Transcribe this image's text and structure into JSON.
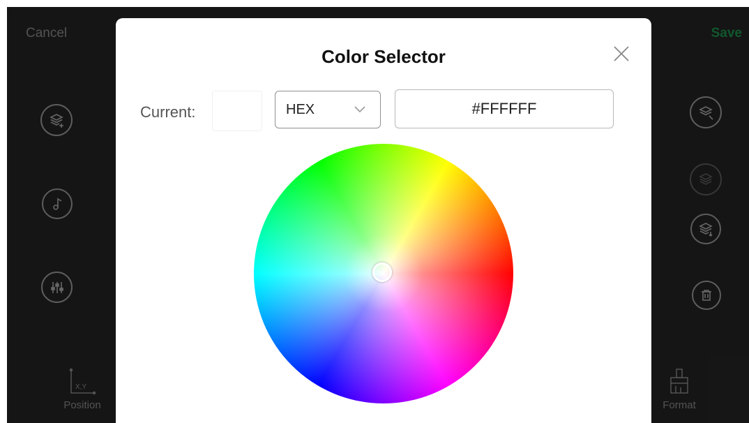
{
  "header": {
    "cancel_label": "Cancel",
    "save_label": "Save"
  },
  "toolbar_left": [
    {
      "icon": "add-layer-icon"
    },
    {
      "icon": "music-note-icon"
    },
    {
      "icon": "equalizer-icon"
    }
  ],
  "toolbar_right": [
    {
      "icon": "select-layer-icon"
    },
    {
      "icon": "layer-up-icon",
      "disabled": true
    },
    {
      "icon": "layer-down-icon"
    },
    {
      "icon": "trash-icon"
    }
  ],
  "bottom_tools": {
    "position": {
      "label": "Position",
      "icon_text": "X,Y"
    },
    "format": {
      "label": "Format"
    }
  },
  "dialog": {
    "title": "Color Selector",
    "current_label": "Current:",
    "current_color": "#FFFFFF",
    "format_value": "HEX",
    "hex_value": "#FFFFFF"
  },
  "colors": {
    "save_green": "#17753C",
    "background": "#1D1D1D"
  }
}
